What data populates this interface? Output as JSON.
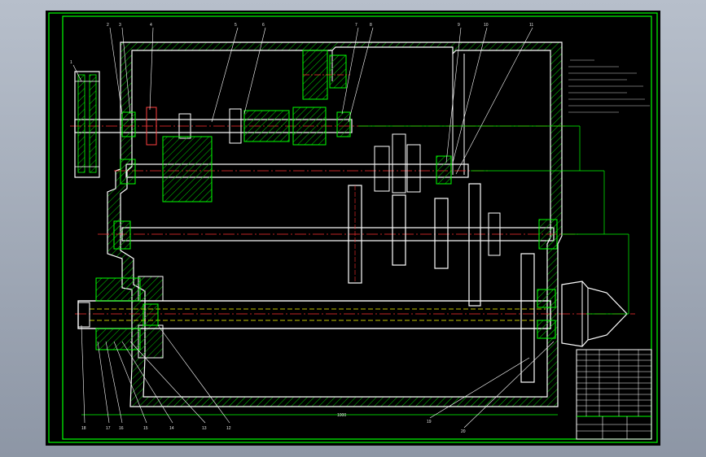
{
  "colors": {
    "frame": "#00ff00",
    "outline": "#ffffff",
    "hatch": "#00cc00",
    "centerline": "#ff3030",
    "gear_edge": "#ff4040",
    "dimension": "#00ff00",
    "hidden_line": "#ffff00",
    "text": "#e8e8e8"
  },
  "part_numbers_top": [
    "1",
    "2",
    "3",
    "4",
    "5",
    "6",
    "7",
    "8",
    "9",
    "10",
    "11"
  ],
  "part_numbers_bottom": [
    "18",
    "17",
    "16",
    "15",
    "14",
    "13",
    "12",
    "20",
    "19"
  ],
  "overall_dimension": "1000",
  "icons": [
    "drawing-sheet",
    "gearbox-housing",
    "shaft",
    "gear",
    "pulley",
    "bearing",
    "chuck-center"
  ]
}
